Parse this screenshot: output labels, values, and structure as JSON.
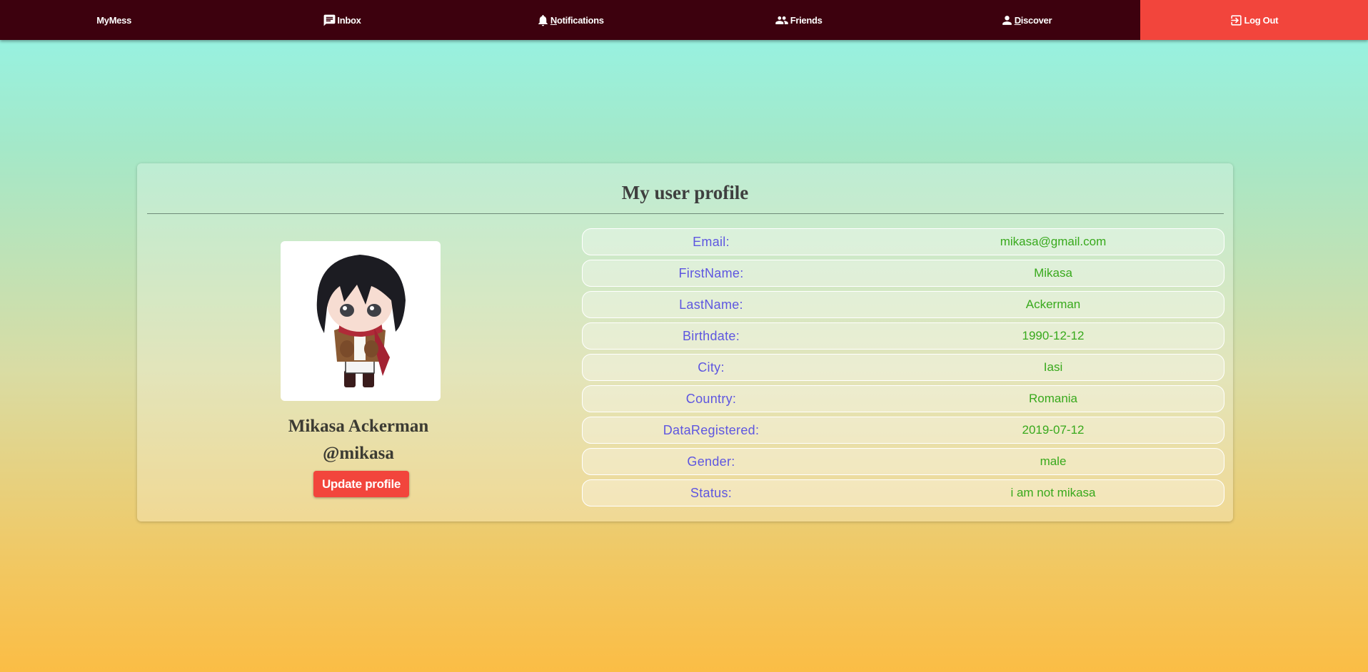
{
  "nav": {
    "brand": "MyMess",
    "inbox": "Inbox",
    "notifications_first": "N",
    "notifications_rest": "otifications",
    "friends": "Friends",
    "discover_first": "D",
    "discover_rest": "iscover",
    "logout": "Log Out"
  },
  "profile": {
    "title": "My user profile",
    "full_name": "Mikasa Ackerman",
    "username": "@mikasa",
    "update_label": "Update profile"
  },
  "fields": [
    {
      "label": "Email:",
      "value": "mikasa@gmail.com"
    },
    {
      "label": "FirstName:",
      "value": "Mikasa"
    },
    {
      "label": "LastName:",
      "value": "Ackerman"
    },
    {
      "label": "Birthdate:",
      "value": "1990-12-12"
    },
    {
      "label": "City:",
      "value": "Iasi"
    },
    {
      "label": "Country:",
      "value": "Romania"
    },
    {
      "label": "DataRegistered:",
      "value": "2019-07-12"
    },
    {
      "label": "Gender:",
      "value": "male"
    },
    {
      "label": "Status:",
      "value": "i am not mikasa"
    }
  ],
  "colors": {
    "nav_bg": "#3d010e",
    "accent_red": "#f2453c",
    "label_blue": "#5e56e0",
    "value_green": "#38a91c"
  }
}
